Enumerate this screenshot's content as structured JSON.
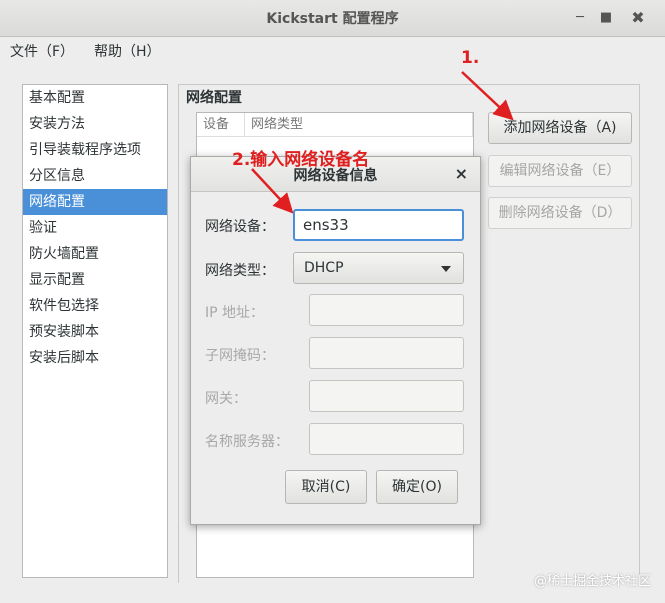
{
  "window": {
    "title": "Kickstart 配置程序",
    "minimize_icon": "minimize-icon",
    "maximize_icon": "maximize-icon",
    "close_icon": "close-icon"
  },
  "menubar": {
    "file": "文件（F）",
    "help": "帮助（H）"
  },
  "sidebar": {
    "items": [
      "基本配置",
      "安装方法",
      "引导装载程序选项",
      "分区信息",
      "网络配置",
      "验证",
      "防火墙配置",
      "显示配置",
      "软件包选择",
      "预安装脚本",
      "安装后脚本"
    ],
    "selected_index": 4
  },
  "network": {
    "section_label": "网络配置",
    "columns": [
      "设备",
      "网络类型"
    ],
    "add_button": "添加网络设备（A)",
    "edit_button": "编辑网络设备（E）",
    "delete_button": "删除网络设备（D）"
  },
  "dialog": {
    "title": "网络设备信息",
    "device_label": "网络设备：",
    "device_value": "ens33",
    "type_label": "网络类型：",
    "type_value": "DHCP",
    "ip_label": "IP 地址：",
    "subnet_label": "子网掩码：",
    "gateway_label": "网关：",
    "dns_label": "名称服务器：",
    "cancel": "取消(C)",
    "ok": "确定(O)"
  },
  "annotations": {
    "step1": "1.",
    "step2": "2.输入网络设备名",
    "color": "#e02020"
  },
  "watermark": "@稀土掘金技术社区"
}
